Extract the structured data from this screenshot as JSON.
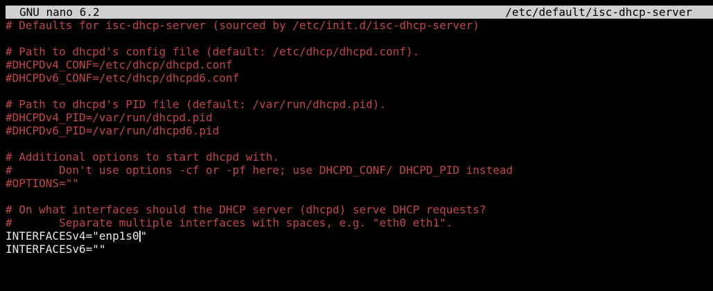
{
  "titlebar": {
    "app": "GNU nano 6.2",
    "file": "/etc/default/isc-dhcp-server"
  },
  "colors": {
    "comment": "#c0454a",
    "code": "#e8e8e8",
    "titlebar_bg": "#d0d0d0",
    "background": "#000000"
  },
  "lines": [
    "# Defaults for isc-dhcp-server (sourced by /etc/init.d/isc-dhcp-server)",
    "",
    "# Path to dhcpd's config file (default: /etc/dhcp/dhcpd.conf).",
    "#DHCPDv4_CONF=/etc/dhcp/dhcpd.conf",
    "#DHCPDv6_CONF=/etc/dhcp/dhcpd6.conf",
    "",
    "# Path to dhcpd's PID file (default: /var/run/dhcpd.pid).",
    "#DHCPDv4_PID=/var/run/dhcpd.pid",
    "#DHCPDv6_PID=/var/run/dhcpd6.pid",
    "",
    "# Additional options to start dhcpd with.",
    "#       Don't use options -cf or -pf here; use DHCPD_CONF/ DHCPD_PID instead",
    "#OPTIONS=\"\"",
    "",
    "# On what interfaces should the DHCP server (dhcpd) serve DHCP requests?",
    "#       Separate multiple interfaces with spaces, e.g. \"eth0 eth1\".",
    "INTERFACESv4=\"enp1s0",
    "\"",
    "INTERFACESv6=\"\""
  ]
}
